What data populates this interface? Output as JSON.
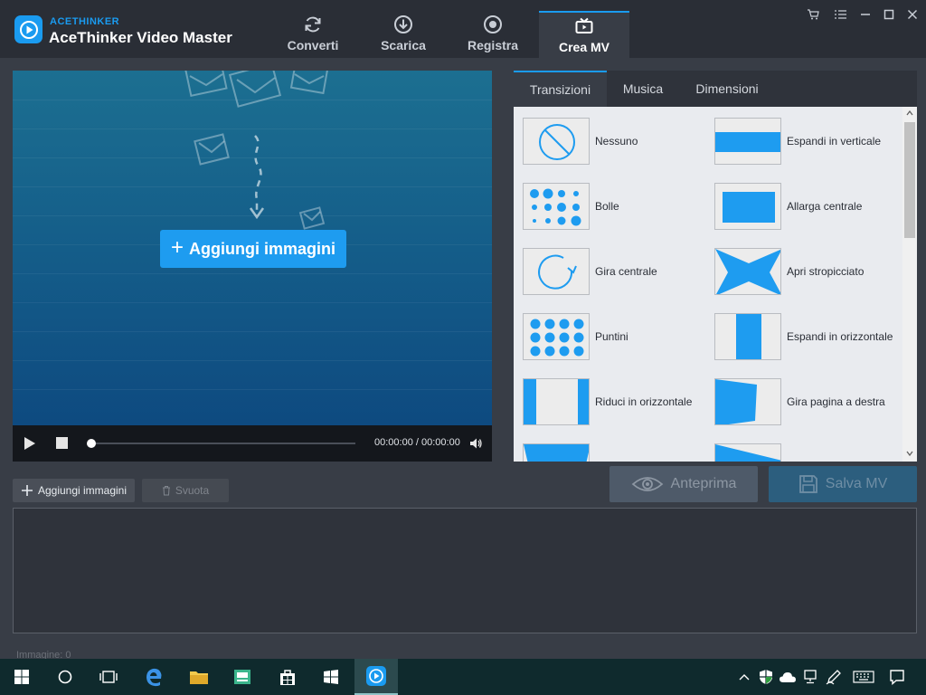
{
  "app": {
    "brand": "ACETHINKER",
    "title": "AceThinker Video Master"
  },
  "nav": [
    {
      "label": "Converti",
      "icon": "refresh-icon"
    },
    {
      "label": "Scarica",
      "icon": "download-icon"
    },
    {
      "label": "Registra",
      "icon": "record-icon"
    },
    {
      "label": "Crea MV",
      "icon": "tv-icon",
      "active": true
    }
  ],
  "preview": {
    "add_label": "Aggiungi immagini",
    "time": "00:00:00 / 00:00:00",
    "progress": 0
  },
  "tabs": [
    {
      "label": "Transizioni",
      "active": true
    },
    {
      "label": "Musica"
    },
    {
      "label": "Dimensioni"
    }
  ],
  "transitions": [
    {
      "label": "Nessuno",
      "icon": "no-entry-icon"
    },
    {
      "label": "Espandi in verticale",
      "icon": "expand-vertical-icon"
    },
    {
      "label": "Bolle",
      "icon": "bubbles-icon"
    },
    {
      "label": "Allarga centrale",
      "icon": "widen-center-icon"
    },
    {
      "label": "Gira centrale",
      "icon": "rotate-center-icon"
    },
    {
      "label": "Apri stropicciato",
      "icon": "crumple-open-icon"
    },
    {
      "label": "Puntini",
      "icon": "dots-icon"
    },
    {
      "label": "Espandi in orizzontale",
      "icon": "expand-horizontal-icon"
    },
    {
      "label": "Riduci in orizzontale",
      "icon": "shrink-horizontal-icon"
    },
    {
      "label": "Gira pagina a destra",
      "icon": "page-turn-right-icon"
    }
  ],
  "actions": {
    "add_images": "Aggiungi immagini",
    "clear": "Svuota",
    "preview": "Anteprima",
    "save": "Salva MV"
  },
  "status": {
    "images_count": "Immagine: 0"
  },
  "colors": {
    "accent": "#1a9bf0",
    "background": "#383d46",
    "titlebar": "#2a2e36"
  }
}
